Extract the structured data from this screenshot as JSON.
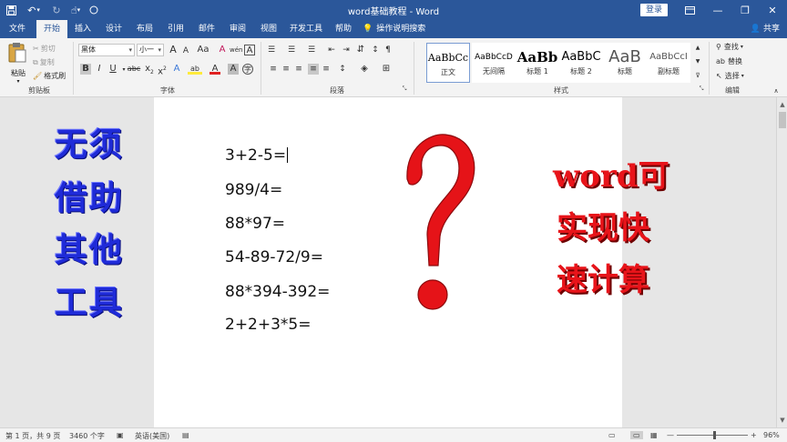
{
  "titlebar": {
    "title": "word基础教程 - Word",
    "login_label": "登录",
    "quick_access": {
      "save_icon": "save-icon",
      "undo_icon": "undo-icon",
      "redo_icon": "redo-icon",
      "touch_icon": "touch-mode-icon",
      "circle_icon": "customize-icon"
    },
    "window_buttons": {
      "ribbon_icon": "ribbon-display-icon",
      "minimize": "—",
      "maximize": "❐",
      "close": "✕"
    }
  },
  "ribbon_tabs": {
    "file": "文件",
    "home": "开始",
    "insert": "插入",
    "design": "设计",
    "layout": "布局",
    "references": "引用",
    "mailings": "邮件",
    "review": "审阅",
    "view": "视图",
    "developer": "开发工具",
    "help": "帮助",
    "tell_me": "操作说明搜索",
    "share": "共享"
  },
  "clipboard": {
    "paste": "粘贴",
    "cut": "剪切",
    "copy": "复制",
    "format_painter": "格式刷",
    "group_label": "剪贴板"
  },
  "font_group": {
    "font_name": "黑体",
    "font_size": "小一",
    "group_label": "字体",
    "grow_font": "A",
    "shrink_font": "A",
    "change_case": "Aa",
    "clear_format": "A",
    "phonetic": "wén",
    "char_border": "A",
    "bold": "B",
    "italic": "I",
    "underline": "U",
    "strikethrough": "abc",
    "subscript": "x",
    "subscript_mark": "2",
    "superscript": "x",
    "superscript_mark": "2",
    "text_effects": "A",
    "highlight": "ab",
    "font_color": "A",
    "char_shading": "A",
    "enclose_char": "字"
  },
  "paragraph_group": {
    "group_label": "段落"
  },
  "styles_group": {
    "group_label": "样式",
    "styles": [
      {
        "sample": "AaBbCc",
        "name": "正文"
      },
      {
        "sample": "AaBbCcD",
        "name": "无间隔"
      },
      {
        "sample": "AaBb",
        "name": "标题 1"
      },
      {
        "sample": "AaBbC",
        "name": "标题 2"
      },
      {
        "sample": "AaB",
        "name": "标题"
      },
      {
        "sample": "AaBbCcI",
        "name": "副标题"
      }
    ]
  },
  "editing_group": {
    "find": "查找",
    "replace": "替换",
    "select": "选择",
    "group_label": "编辑"
  },
  "document": {
    "equations": [
      "3+2-5=",
      "989/4=",
      "88*97=",
      "54-89-72/9=",
      "88*394-392=",
      "2+2+3*5="
    ]
  },
  "overlays": {
    "left_lines": [
      "无须",
      "借助",
      "其他",
      "工具"
    ],
    "right_lines": [
      "word可",
      "实现快",
      "速计算"
    ],
    "question_mark": "?",
    "left_color": "#1f2bd8",
    "right_color": "#e8141a"
  },
  "statusbar": {
    "page_info": "第 1 页，共 9 页",
    "word_count": "3460 个字",
    "language": "英语(美国)",
    "zoom": "96%"
  },
  "colors": {
    "title_blue": "#2b579a",
    "ribbon_bg": "#f3f3f3"
  }
}
